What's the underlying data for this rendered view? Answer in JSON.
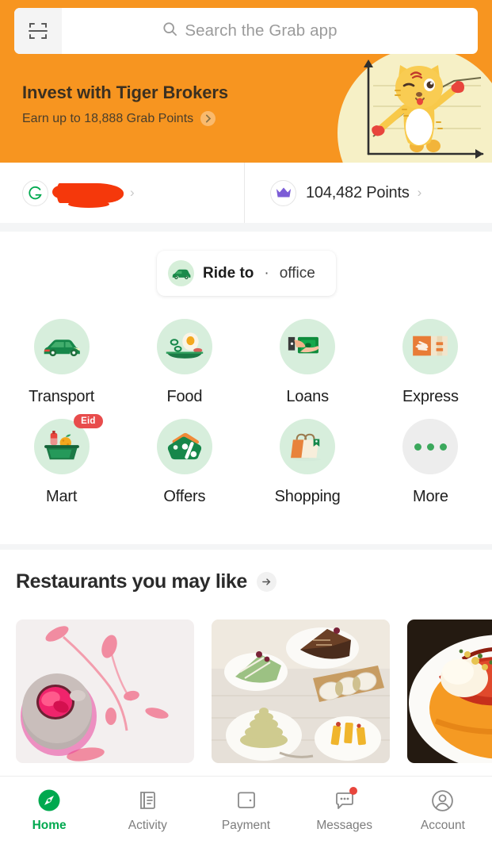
{
  "search": {
    "placeholder": "Search the Grab app",
    "scan_icon": "scan-qr-icon",
    "search_icon": "search-icon"
  },
  "banner": {
    "title": "Invest with Tiger Brokers",
    "subtitle": "Earn up to 18,888 Grab Points",
    "chevron": "›",
    "mascot": "tiger-mascot-chart-illustration",
    "bg_color": "#F79520",
    "circle_color": "#F6F0C6"
  },
  "account_row": {
    "profile": {
      "icon": "grab-g-logo-icon",
      "name_redacted": true,
      "chevron": "›"
    },
    "points": {
      "icon": "crown-icon",
      "icon_color": "#7B5CD6",
      "value": "104,482 Points",
      "chevron": "›"
    }
  },
  "ride_chip": {
    "icon": "car-icon",
    "label": "Ride to",
    "separator": "·",
    "destination": "office"
  },
  "services": [
    {
      "label": "Transport",
      "icon": "car-icon",
      "badge": null
    },
    {
      "label": "Food",
      "icon": "egg-plate-icon",
      "badge": null
    },
    {
      "label": "Loans",
      "icon": "hand-money-icon",
      "badge": null
    },
    {
      "label": "Express",
      "icon": "parcel-hand-icon",
      "badge": null
    },
    {
      "label": "Mart",
      "icon": "grocery-basket-icon",
      "badge": "Eid"
    },
    {
      "label": "Offers",
      "icon": "percent-tag-icon",
      "badge": null
    },
    {
      "label": "Shopping",
      "icon": "shopping-bags-icon",
      "badge": null
    },
    {
      "label": "More",
      "icon": "ellipsis-icon",
      "badge": null
    }
  ],
  "restaurants": {
    "title": "Restaurants you may like",
    "arrow": "→",
    "cards": [
      {
        "alt": "pink-rose-dessert-photo"
      },
      {
        "alt": "assorted-cakes-platter-photo"
      },
      {
        "alt": "baked-lobster-dish-photo"
      }
    ]
  },
  "bottom_nav": {
    "items": [
      {
        "label": "Home",
        "icon": "compass-icon",
        "active": true,
        "badge": false
      },
      {
        "label": "Activity",
        "icon": "list-page-icon",
        "active": false,
        "badge": false
      },
      {
        "label": "Payment",
        "icon": "wallet-icon",
        "active": false,
        "badge": false
      },
      {
        "label": "Messages",
        "icon": "chat-bubble-icon",
        "active": false,
        "badge": true
      },
      {
        "label": "Account",
        "icon": "user-circle-icon",
        "active": false,
        "badge": false
      }
    ],
    "active_color": "#00A94F",
    "inactive_color": "#7D7D7D"
  }
}
